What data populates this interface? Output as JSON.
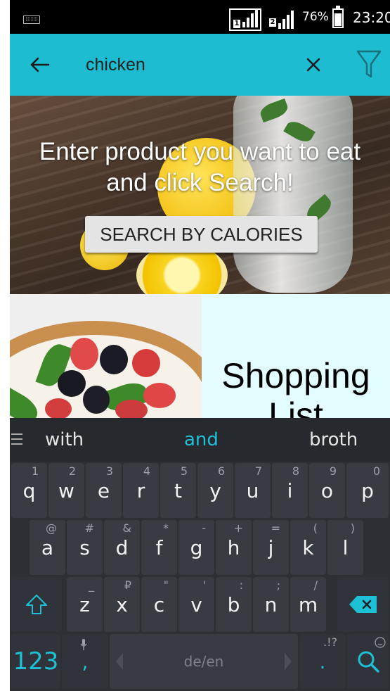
{
  "status_bar": {
    "sim1": "1",
    "sim2": "2",
    "battery": "76%",
    "time": "23:20"
  },
  "app_bar": {
    "search_value": "chicken",
    "back_icon": "arrow-left-icon",
    "clear_icon": "close-icon",
    "filter_icon": "filter-funnel-icon",
    "color": "#1ebcd0"
  },
  "hero": {
    "message_line1": "Enter product you want to eat",
    "message_line2": "and click Search!",
    "button_label": "SEARCH BY CALORIES"
  },
  "tiles": {
    "shopping_list_label": "Shopping List"
  },
  "keyboard": {
    "suggestions": [
      "with",
      "and",
      "broth"
    ],
    "active_suggestion_index": 1,
    "accent": "#1ec0d6",
    "row1": [
      {
        "key": "q",
        "hint": "1"
      },
      {
        "key": "w",
        "hint": "2"
      },
      {
        "key": "e",
        "hint": "3"
      },
      {
        "key": "r",
        "hint": "4"
      },
      {
        "key": "t",
        "hint": "5"
      },
      {
        "key": "y",
        "hint": "6"
      },
      {
        "key": "u",
        "hint": "7"
      },
      {
        "key": "i",
        "hint": "8"
      },
      {
        "key": "o",
        "hint": "9"
      },
      {
        "key": "p",
        "hint": "0"
      }
    ],
    "row2": [
      {
        "key": "a",
        "hint": "@"
      },
      {
        "key": "s",
        "hint": "#"
      },
      {
        "key": "d",
        "hint": "&"
      },
      {
        "key": "f",
        "hint": "*"
      },
      {
        "key": "g",
        "hint": "-"
      },
      {
        "key": "h",
        "hint": "+"
      },
      {
        "key": "j",
        "hint": "="
      },
      {
        "key": "k",
        "hint": "("
      },
      {
        "key": "l",
        "hint": ")"
      }
    ],
    "row3": [
      {
        "key": "z",
        "hint": "_"
      },
      {
        "key": "x",
        "hint": "₽"
      },
      {
        "key": "c",
        "hint": "\""
      },
      {
        "key": "v",
        "hint": "'"
      },
      {
        "key": "b",
        "hint": ":"
      },
      {
        "key": "n",
        "hint": ";"
      },
      {
        "key": "m",
        "hint": "/"
      }
    ],
    "numbers_key": "123",
    "comma_key": ",",
    "space_label": "de/en",
    "period_key": ".",
    "period_hint": ".!?"
  }
}
